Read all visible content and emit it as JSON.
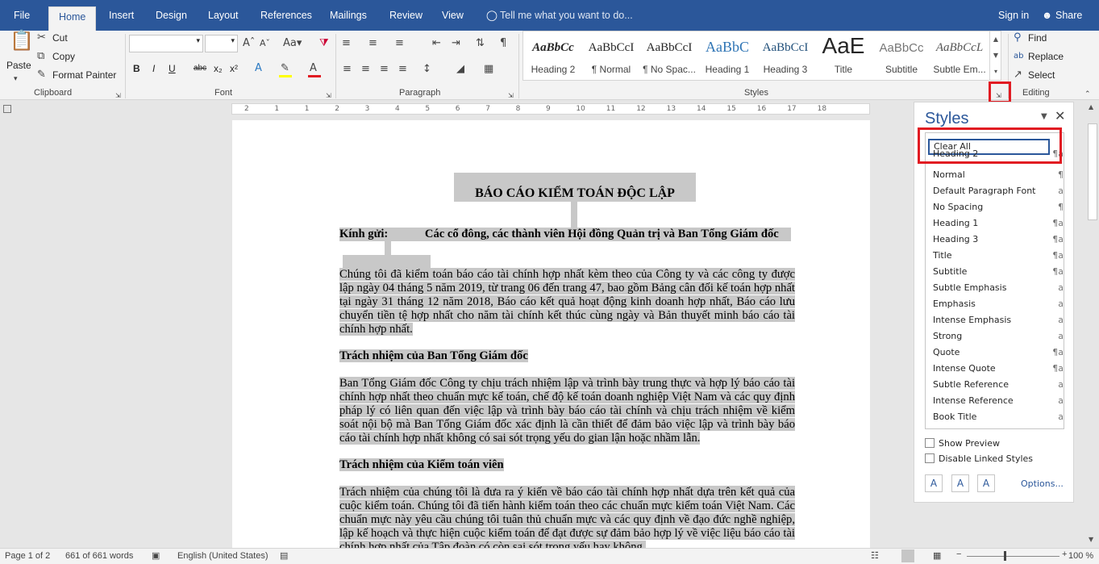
{
  "menu": {
    "file": "File",
    "home": "Home",
    "insert": "Insert",
    "design": "Design",
    "layout": "Layout",
    "references": "References",
    "mailings": "Mailings",
    "review": "Review",
    "view": "View",
    "tell_me": "Tell me what you want to do...",
    "sign_in": "Sign in",
    "share": "Share"
  },
  "clipboard": {
    "paste": "Paste",
    "cut": "Cut",
    "copy": "Copy",
    "format_painter": "Format Painter",
    "label": "Clipboard"
  },
  "font": {
    "label": "Font",
    "bold": "B",
    "italic": "I",
    "underline": "U",
    "strike": "abc",
    "sub": "x₂",
    "sup": "x²"
  },
  "paragraph": {
    "label": "Paragraph"
  },
  "styles_gallery": {
    "label": "Styles",
    "items": [
      {
        "sample": "AaBbCc",
        "name": "Heading 2"
      },
      {
        "sample": "AaBbCcI",
        "name": "¶ Normal"
      },
      {
        "sample": "AaBbCcI",
        "name": "¶ No Spac..."
      },
      {
        "sample": "AaBbC",
        "name": "Heading 1"
      },
      {
        "sample": "AaBbCcI",
        "name": "Heading 3"
      },
      {
        "sample": "AaE",
        "name": "Title"
      },
      {
        "sample": "AaBbCc",
        "name": "Subtitle"
      },
      {
        "sample": "AaBbCcL",
        "name": "Subtle Em..."
      }
    ]
  },
  "editing": {
    "label": "Editing",
    "find": "Find",
    "replace": "Replace",
    "select": "Select"
  },
  "ruler": {
    "ticks": [
      "2",
      "1",
      "1",
      "2",
      "3",
      "4",
      "5",
      "6",
      "7",
      "8",
      "9",
      "10",
      "11",
      "12",
      "13",
      "14",
      "15",
      "16",
      "17",
      "18"
    ]
  },
  "document": {
    "title": "BÁO CÁO KIỂM TOÁN ĐỘC LẬP",
    "greeting_label": "Kính gửi:",
    "greeting_to": "Các cổ đông, các thành viên Hội đồng Quản trị và Ban Tổng Giám đốc",
    "para1": "Chúng tôi đã kiểm toán báo cáo tài chính hợp nhất kèm theo của Công ty và các công ty được lập ngày 04 tháng 5 năm 2019, từ trang 06 đến trang 47, bao gồm Bảng cân đối kế toán hợp nhất tại ngày 31 tháng 12 năm 2018, Báo cáo kết quả hoạt động kinh doanh hợp nhất, Báo cáo lưu chuyển tiền tệ hợp nhất cho năm tài chính kết thúc cùng ngày và Bản thuyết minh báo cáo tài chính hợp nhất.",
    "heading1": "Trách nhiệm của Ban Tổng Giám đốc",
    "para2": "Ban Tổng Giám đốc Công ty chịu trách nhiệm lập và trình bày trung thực và hợp lý báo cáo tài chính hợp nhất theo chuẩn mực kế toán, chế độ kế toán doanh nghiệp Việt Nam và các quy định pháp lý có liên quan đến việc lập và trình bày báo cáo tài chính và chịu trách nhiệm về kiểm soát nội bộ mà Ban Tổng Giám đốc xác định là cần thiết để đảm bảo việc lập và trình bày báo cáo tài chính hợp nhất không có sai sót trọng yếu do gian lận hoặc nhầm lẫn.",
    "heading2": "Trách nhiệm của Kiểm toán viên",
    "para3": "Trách nhiệm của chúng tôi là đưa ra ý kiến về báo cáo tài chính hợp nhất dựa trên kết quả của cuộc kiểm toán. Chúng tôi đã tiến hành kiểm toán theo các chuẩn mực kiểm toán Việt Nam. Các chuẩn mực này yêu cầu chúng tôi tuân thủ chuẩn mực và các quy định về đạo đức nghề nghiệp, lập kế hoạch và thực hiện cuộc kiểm toán để đạt được sự đảm bảo hợp lý về việc liệu báo cáo tài chính hợp nhất của Tập đoàn có còn sai sót trọng yếu hay không."
  },
  "styles_pane": {
    "title": "Styles",
    "clear_all": "Clear All",
    "items": [
      {
        "name": "Heading 2",
        "glyph": "¶a"
      },
      {
        "name": "Normal",
        "glyph": "¶"
      },
      {
        "name": "Default Paragraph Font",
        "glyph": "a"
      },
      {
        "name": "No Spacing",
        "glyph": "¶"
      },
      {
        "name": "Heading 1",
        "glyph": "¶a"
      },
      {
        "name": "Heading 3",
        "glyph": "¶a"
      },
      {
        "name": "Title",
        "glyph": "¶a"
      },
      {
        "name": "Subtitle",
        "glyph": "¶a"
      },
      {
        "name": "Subtle Emphasis",
        "glyph": "a"
      },
      {
        "name": "Emphasis",
        "glyph": "a"
      },
      {
        "name": "Intense Emphasis",
        "glyph": "a"
      },
      {
        "name": "Strong",
        "glyph": "a"
      },
      {
        "name": "Quote",
        "glyph": "¶a"
      },
      {
        "name": "Intense Quote",
        "glyph": "¶a"
      },
      {
        "name": "Subtle Reference",
        "glyph": "a"
      },
      {
        "name": "Intense Reference",
        "glyph": "a"
      },
      {
        "name": "Book Title",
        "glyph": "a"
      }
    ],
    "show_preview": "Show Preview",
    "disable_linked": "Disable Linked Styles",
    "options": "Options..."
  },
  "status": {
    "page": "Page 1 of 2",
    "words": "661 of 661 words",
    "language": "English (United States)",
    "zoom": "100 %"
  },
  "colors": {
    "brand": "#2b579a",
    "highlight": "#c8c8c8",
    "callout": "#e11b22"
  }
}
